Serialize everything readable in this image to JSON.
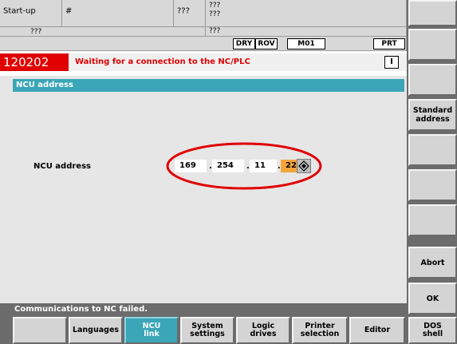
{
  "header": {
    "mode": "Start-up",
    "hash": "#",
    "mark1": "???",
    "mark2": "???",
    "line1": "???",
    "line2": "???",
    "line3": "???",
    "line4": "???",
    "indicators": [
      "DRY",
      "ROV",
      "M01",
      "PRT"
    ]
  },
  "alarm": {
    "number": "120202",
    "text": "Waiting for a connection to the NC/PLC",
    "ack_label": "I"
  },
  "dialog": {
    "title": "NCU address",
    "field_label": "NCU address",
    "octets": [
      "169",
      "254",
      "11",
      "22"
    ],
    "separator": "."
  },
  "vertical_softkeys": [
    "",
    "",
    "",
    "Standard address",
    "",
    "",
    "",
    "Abort",
    "OK"
  ],
  "horizontal_softkeys": [
    "",
    "Languages",
    "NCU link",
    "System settings",
    "Logic drives",
    "Printer selection",
    "Editor",
    "DOS shell"
  ],
  "status_message": "Communications to NC failed.",
  "colors": {
    "accent": "#3aa6b7",
    "alarm": "#e00000",
    "active_field": "#f4a53a",
    "highlight_ellipse": "#e00000"
  }
}
